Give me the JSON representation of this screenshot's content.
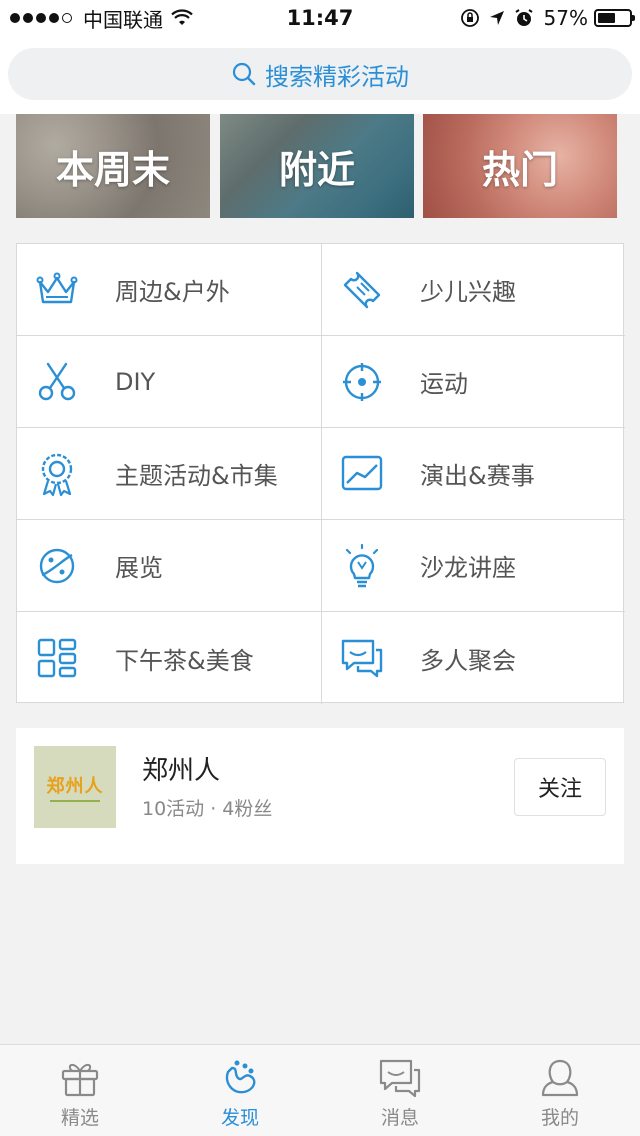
{
  "status_bar": {
    "carrier": "中国联通",
    "time": "11:47",
    "battery_percent": "57%",
    "battery_level": 0.57
  },
  "search": {
    "placeholder": "搜索精彩活动",
    "icon": "search-icon"
  },
  "banners": [
    {
      "label": "本周末"
    },
    {
      "label": "附近"
    },
    {
      "label": "热门"
    }
  ],
  "categories": [
    {
      "label": "周边&户外",
      "icon": "crown-icon"
    },
    {
      "label": "少儿兴趣",
      "icon": "ticket-icon"
    },
    {
      "label": "DIY",
      "icon": "scissors-icon"
    },
    {
      "label": "运动",
      "icon": "target-icon"
    },
    {
      "label": "主题活动&市集",
      "icon": "badge-icon"
    },
    {
      "label": "演出&赛事",
      "icon": "chart-frame-icon"
    },
    {
      "label": "展览",
      "icon": "planet-icon"
    },
    {
      "label": "沙龙讲座",
      "icon": "lightbulb-icon"
    },
    {
      "label": "下午茶&美食",
      "icon": "grid-icon"
    },
    {
      "label": "多人聚会",
      "icon": "chat-bubbles-icon"
    }
  ],
  "organizer": {
    "name": "郑州人",
    "logo_text": "郑州人",
    "stats": "10活动 · 4粉丝",
    "follow_label": "关注"
  },
  "tab_bar": {
    "active": "discover",
    "items": [
      {
        "id": "featured",
        "label": "精选",
        "icon": "gift-icon"
      },
      {
        "id": "discover",
        "label": "发现",
        "icon": "footprint-icon"
      },
      {
        "id": "messages",
        "label": "消息",
        "icon": "message-icon"
      },
      {
        "id": "mine",
        "label": "我的",
        "icon": "person-icon"
      }
    ]
  },
  "colors": {
    "accent": "#2b8fd6",
    "background": "#f2f2f2",
    "border": "#d9d9d9"
  }
}
